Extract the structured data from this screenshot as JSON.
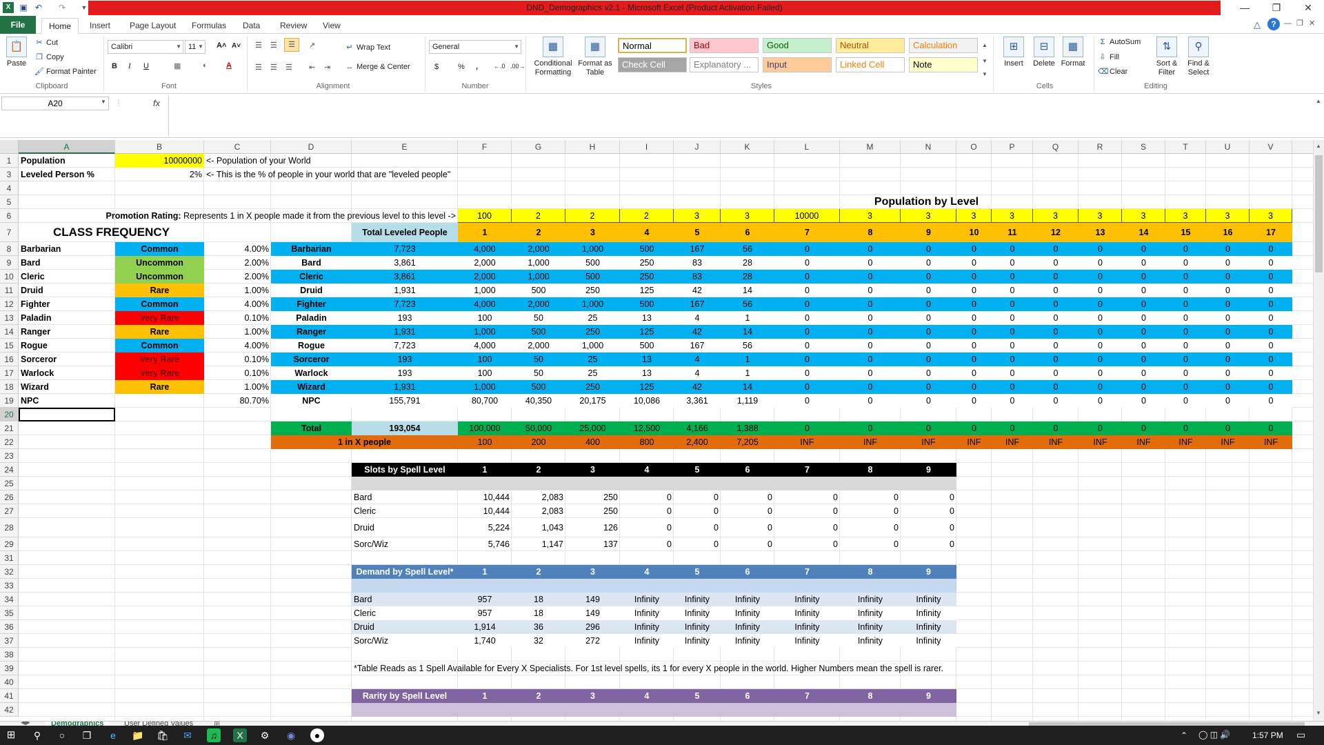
{
  "window": {
    "title": "DND_Demographics v2.1  -  Microsoft Excel (Product Activation Failed)"
  },
  "ribbon_tabs": [
    "File",
    "Home",
    "Insert",
    "Page Layout",
    "Formulas",
    "Data",
    "Review",
    "View"
  ],
  "active_tab": "Home",
  "clipboard": {
    "paste": "Paste",
    "cut": "Cut",
    "copy": "Copy",
    "format_painter": "Format Painter",
    "label": "Clipboard"
  },
  "font": {
    "name": "Calibri",
    "size": "11",
    "label": "Font"
  },
  "alignment": {
    "wrap": "Wrap Text",
    "merge": "Merge & Center",
    "label": "Alignment"
  },
  "number": {
    "format": "General",
    "label": "Number"
  },
  "styles_group": {
    "conditional": "Conditional Formatting",
    "format_table": "Format as Table",
    "label": "Styles",
    "cells": [
      {
        "text": "Normal",
        "bg": "#ffffff",
        "fg": "#000000"
      },
      {
        "text": "Bad",
        "bg": "#ffc7ce",
        "fg": "#9c0006"
      },
      {
        "text": "Good",
        "bg": "#c6efce",
        "fg": "#006100"
      },
      {
        "text": "Neutral",
        "bg": "#ffeb9c",
        "fg": "#9c5700"
      },
      {
        "text": "Calculation",
        "bg": "#f2f2f2",
        "fg": "#fa7d00"
      },
      {
        "text": "Check Cell",
        "bg": "#a5a5a5",
        "fg": "#ffffff"
      },
      {
        "text": "Explanatory ...",
        "bg": "#ffffff",
        "fg": "#7f7f7f"
      },
      {
        "text": "Input",
        "bg": "#ffcc99",
        "fg": "#3f3f76"
      },
      {
        "text": "Linked Cell",
        "bg": "#ffffff",
        "fg": "#fa7d00"
      },
      {
        "text": "Note",
        "bg": "#ffffcc",
        "fg": "#000000"
      }
    ]
  },
  "cells_group": {
    "insert": "Insert",
    "delete": "Delete",
    "format": "Format",
    "label": "Cells"
  },
  "editing_group": {
    "autosum": "AutoSum",
    "fill": "Fill",
    "clear": "Clear",
    "sort": "Sort & Filter",
    "find": "Find & Select",
    "label": "Editing"
  },
  "formula_bar": {
    "namebox": "A20",
    "fx": "fx",
    "formula": ""
  },
  "columns": [
    "A",
    "B",
    "C",
    "D",
    "E",
    "F",
    "G",
    "H",
    "I",
    "J",
    "K",
    "L",
    "M",
    "N",
    "O",
    "P",
    "Q",
    "R",
    "S",
    "T",
    "U",
    "V"
  ],
  "rows": [
    "1",
    "3",
    "4",
    "5",
    "6",
    "7",
    "8",
    "9",
    "10",
    "11",
    "12",
    "13",
    "14",
    "15",
    "16",
    "17",
    "18",
    "19",
    "20",
    "21",
    "22",
    "23",
    "24",
    "25",
    "26",
    "27",
    "28",
    "29",
    "31",
    "32",
    "33",
    "34",
    "35",
    "36",
    "37",
    "38",
    "39",
    "40",
    "41",
    "42"
  ],
  "top": {
    "population_label": "Population",
    "population_value": "10000000",
    "population_note": "<- Population of your World",
    "leveled_label": "Leveled Person %",
    "leveled_value": "2%",
    "leveled_note": "<- This is the % of people in your world that are \"leveled people\"",
    "pop_by_level": "Population by Level",
    "promo_label": "Promotion Rating:",
    "promo_text": " Represents 1 in X people made it from the previous level to this level ->",
    "promo_values": [
      "100",
      "2",
      "2",
      "2",
      "3",
      "3",
      "10000",
      "3",
      "3",
      "3",
      "3",
      "3",
      "3",
      "3",
      "3",
      "3",
      "3"
    ],
    "class_freq": "CLASS FREQUENCY",
    "total_leveled": "Total Leveled People",
    "levels": [
      "1",
      "2",
      "3",
      "4",
      "5",
      "6",
      "7",
      "8",
      "9",
      "10",
      "11",
      "12",
      "13",
      "14",
      "15",
      "16",
      "17"
    ]
  },
  "classes": [
    {
      "name": "Barbarian",
      "rarity": "Common",
      "pct": "4.00%",
      "total": "7,723",
      "lv": [
        "4,000",
        "2,000",
        "1,000",
        "500",
        "167",
        "56"
      ]
    },
    {
      "name": "Bard",
      "rarity": "Uncommon",
      "pct": "2.00%",
      "total": "3,861",
      "lv": [
        "2,000",
        "1,000",
        "500",
        "250",
        "83",
        "28"
      ]
    },
    {
      "name": "Cleric",
      "rarity": "Uncommon",
      "pct": "2.00%",
      "total": "3,861",
      "lv": [
        "2,000",
        "1,000",
        "500",
        "250",
        "83",
        "28"
      ]
    },
    {
      "name": "Druid",
      "rarity": "Rare",
      "pct": "1.00%",
      "total": "1,931",
      "lv": [
        "1,000",
        "500",
        "250",
        "125",
        "42",
        "14"
      ]
    },
    {
      "name": "Fighter",
      "rarity": "Common",
      "pct": "4.00%",
      "total": "7,723",
      "lv": [
        "4,000",
        "2,000",
        "1,000",
        "500",
        "167",
        "56"
      ]
    },
    {
      "name": "Paladin",
      "rarity": "Very Rare",
      "pct": "0.10%",
      "total": "193",
      "lv": [
        "100",
        "50",
        "25",
        "13",
        "4",
        "1"
      ]
    },
    {
      "name": "Ranger",
      "rarity": "Rare",
      "pct": "1.00%",
      "total": "1,931",
      "lv": [
        "1,000",
        "500",
        "250",
        "125",
        "42",
        "14"
      ]
    },
    {
      "name": "Rogue",
      "rarity": "Common",
      "pct": "4.00%",
      "total": "7,723",
      "lv": [
        "4,000",
        "2,000",
        "1,000",
        "500",
        "167",
        "56"
      ]
    },
    {
      "name": "Sorceror",
      "rarity": "Very Rare",
      "pct": "0.10%",
      "total": "193",
      "lv": [
        "100",
        "50",
        "25",
        "13",
        "4",
        "1"
      ]
    },
    {
      "name": "Warlock",
      "rarity": "Very Rare",
      "pct": "0.10%",
      "total": "193",
      "lv": [
        "100",
        "50",
        "25",
        "13",
        "4",
        "1"
      ]
    },
    {
      "name": "Wizard",
      "rarity": "Rare",
      "pct": "1.00%",
      "total": "1,931",
      "lv": [
        "1,000",
        "500",
        "250",
        "125",
        "42",
        "14"
      ]
    },
    {
      "name": "NPC",
      "rarity": "",
      "pct": "80.70%",
      "total": "155,791",
      "lv": [
        "80,700",
        "40,350",
        "20,175",
        "10,086",
        "3,361",
        "1,119"
      ]
    }
  ],
  "zero": "0",
  "inf": "INF",
  "totals": {
    "label": "Total",
    "total": "193,054",
    "lv": [
      "100,000",
      "50,000",
      "25,000",
      "12,500",
      "4,166",
      "1,388"
    ]
  },
  "one_in_x": {
    "label": "1 in X people",
    "lv": [
      "100",
      "200",
      "400",
      "800",
      "2,400",
      "7,205"
    ]
  },
  "slots": {
    "title": "Slots by Spell Level",
    "levels": [
      "1",
      "2",
      "3",
      "4",
      "5",
      "6",
      "7",
      "8",
      "9"
    ],
    "rows": [
      {
        "name": "Bard",
        "v": [
          "10,444",
          "2,083",
          "250",
          "0",
          "0",
          "0",
          "0",
          "0",
          "0"
        ]
      },
      {
        "name": "Cleric",
        "v": [
          "10,444",
          "2,083",
          "250",
          "0",
          "0",
          "0",
          "0",
          "0",
          "0"
        ]
      },
      {
        "name": "Druid",
        "v": [
          "5,224",
          "1,043",
          "126",
          "0",
          "0",
          "0",
          "0",
          "0",
          "0"
        ]
      },
      {
        "name": "Sorc/Wiz",
        "v": [
          "5,746",
          "1,147",
          "137",
          "0",
          "0",
          "0",
          "0",
          "0",
          "0"
        ]
      }
    ]
  },
  "demand": {
    "title": "Demand by Spell Level*",
    "rows": [
      {
        "name": "Bard",
        "v": [
          "957",
          "18",
          "149",
          "Infinity",
          "Infinity",
          "Infinity",
          "Infinity",
          "Infinity",
          "Infinity"
        ]
      },
      {
        "name": "Cleric",
        "v": [
          "957",
          "18",
          "149",
          "Infinity",
          "Infinity",
          "Infinity",
          "Infinity",
          "Infinity",
          "Infinity"
        ]
      },
      {
        "name": "Druid",
        "v": [
          "1,914",
          "36",
          "296",
          "Infinity",
          "Infinity",
          "Infinity",
          "Infinity",
          "Infinity",
          "Infinity"
        ]
      },
      {
        "name": "Sorc/Wiz",
        "v": [
          "1,740",
          "32",
          "272",
          "Infinity",
          "Infinity",
          "Infinity",
          "Infinity",
          "Infinity",
          "Infinity"
        ]
      }
    ]
  },
  "footnote": "*Table Reads as 1 Spell Available for Every X Specialists. For 1st level spells, its 1 for every X people in the world. Higher Numbers mean the spell is rarer.",
  "rarity_title": "Rarity by Spell Level",
  "sheets": [
    "Demographics",
    "User Defined Values"
  ],
  "taskbar": {
    "time": "1:57 PM"
  },
  "colors": {
    "excel_green": "#217346",
    "common": "#00b0f0",
    "uncommon": "#92d050",
    "rare": "#ffc000",
    "very_rare": "#ff0000",
    "promo_yellow": "#ffff00",
    "level_orange": "#ffc000",
    "total_green": "#00b050",
    "one_in_x_orange": "#e26b0a",
    "slots_black": "#000000",
    "demand_blue": "#4f81bd",
    "rarity_purple": "#8064a2"
  }
}
